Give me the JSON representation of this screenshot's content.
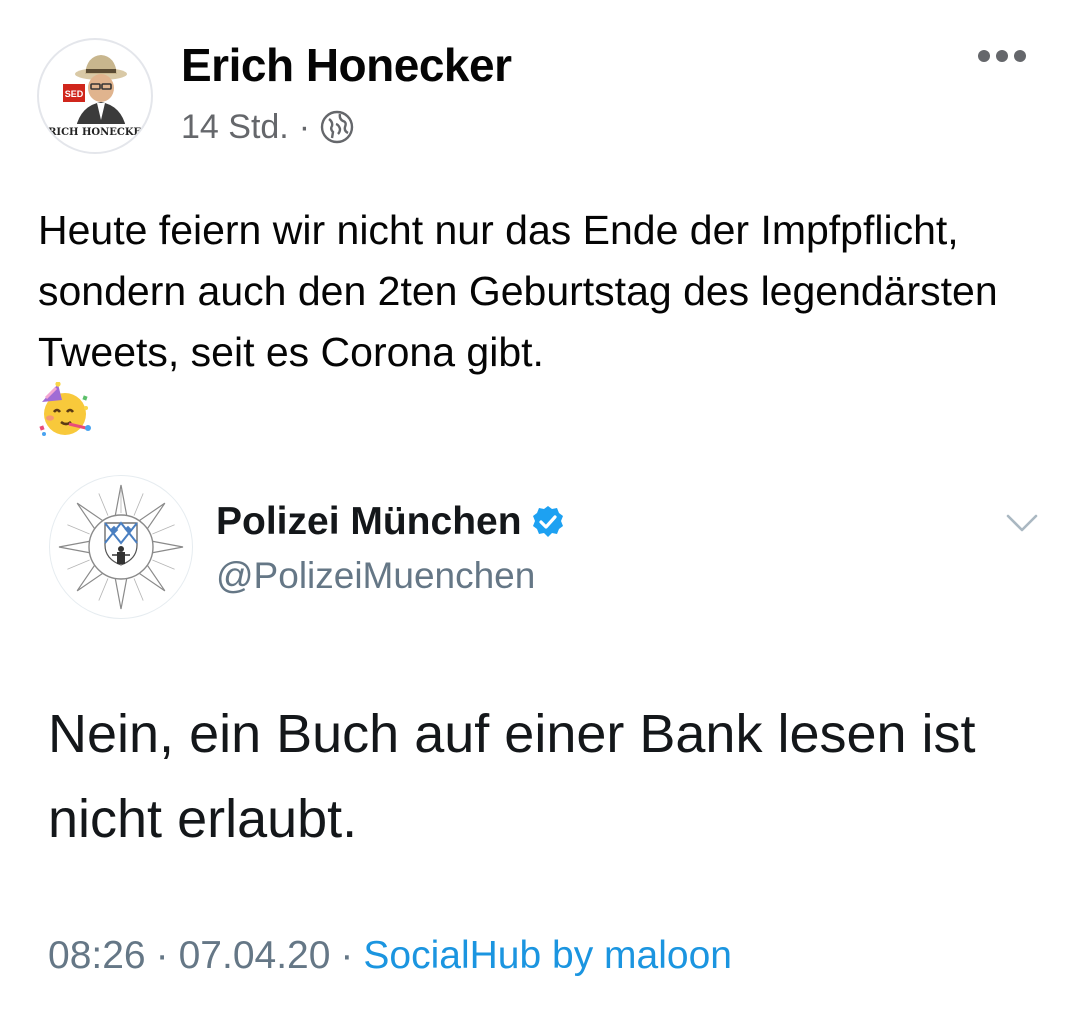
{
  "post": {
    "author": "Erich Honecker",
    "avatar_caption": "ERICH HONECKER",
    "avatar_badge": "SED",
    "time": "14 Std.",
    "separator": "·",
    "audience_icon": "globe-icon",
    "menu_icon": "more-options-icon",
    "text": "Heute feiern wir nicht nur das Ende der Impfpflicht, sondern auch den 2ten Geburtstag des legendärsten Tweets, seit es Corona gibt.",
    "emoji": "partying-face-emoji"
  },
  "tweet": {
    "name": "Polizei München",
    "verified": true,
    "verified_icon": "verified-badge-icon",
    "handle": "@PolizeiMuenchen",
    "menu_icon": "chevron-down-icon",
    "text": "Nein, ein Buch auf einer Bank lesen ist nicht erlaubt.",
    "time": "08:26",
    "date": "07.04.20",
    "source": "SocialHub by maloon",
    "separator": "·"
  },
  "colors": {
    "text_primary": "#050505",
    "text_secondary": "#65676b",
    "tweet_text": "#14171a",
    "tweet_secondary": "#657786",
    "twitter_blue": "#1da1f2",
    "link_blue": "#1b95e0"
  }
}
